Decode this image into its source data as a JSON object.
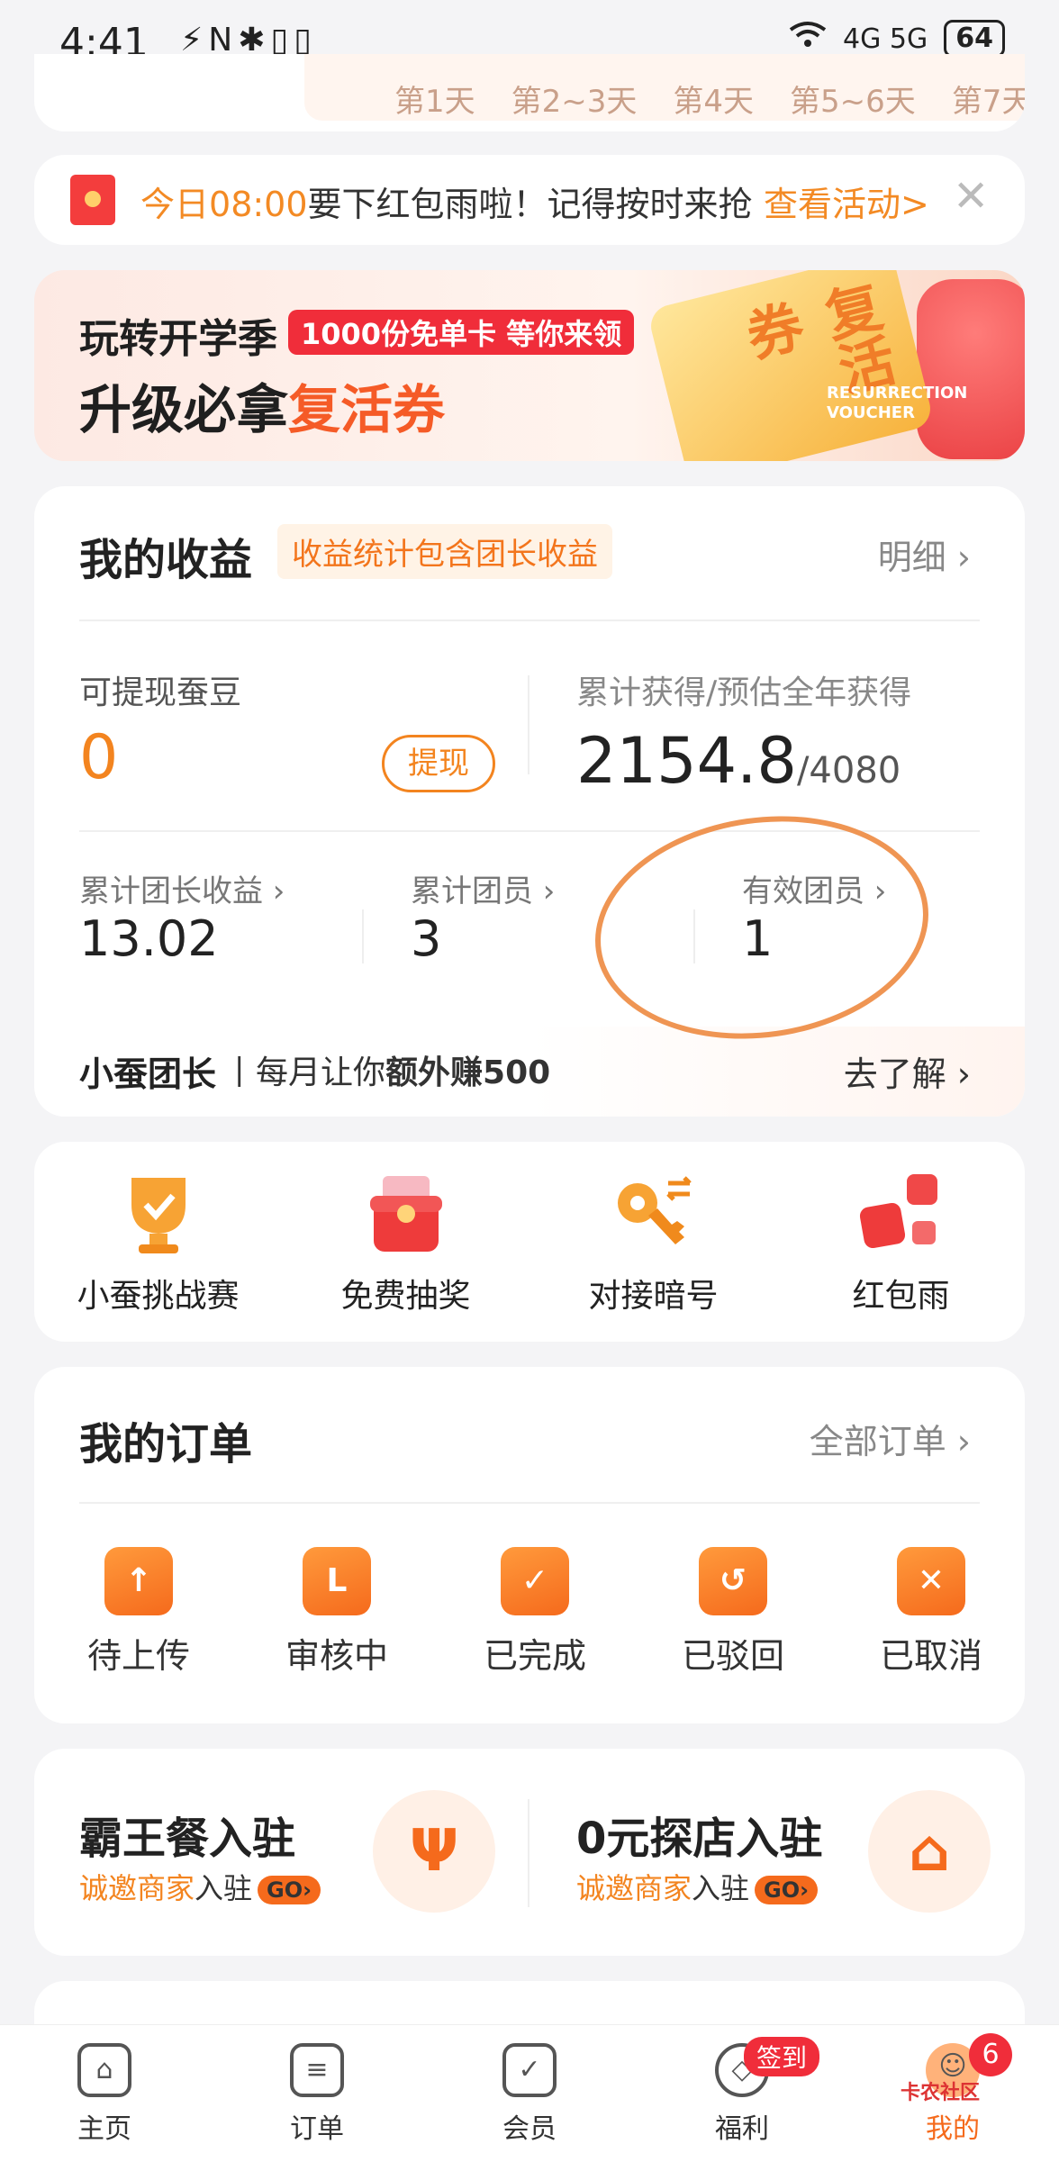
{
  "status_bar": {
    "time": "4:41",
    "left_icons": "⚡N✱▯▯",
    "network": "4G 5G",
    "battery": "64"
  },
  "top_strip": {
    "days": [
      "第1天",
      "第2~3天",
      "第4天",
      "第5~6天",
      "第7天"
    ]
  },
  "notice": {
    "prefix": "今日",
    "time": "08:00",
    "text": "要下红包雨啦！记得按时来抢",
    "link": "查看活动>",
    "close": "✕"
  },
  "banner": {
    "line1": "玩转开学季",
    "badge": "1000份免单卡 等你来领",
    "line2_prefix": "升级必拿",
    "line2_highlight": "复活券",
    "voucher_text": "复活券",
    "voucher_sub": "RESURRECTION VOUCHER"
  },
  "earnings": {
    "title": "我的收益",
    "note": "收益统计包含团长收益",
    "detail": "明细 ›",
    "withdrawable_label": "可提现蚕豆",
    "withdrawable_value": "0",
    "withdraw_button": "提现",
    "total_label": "累计获得/预估全年获得",
    "total_value": "2154.8",
    "total_estimate": "/4080",
    "stats": [
      {
        "label": "累计团长收益 ›",
        "value": "13.02"
      },
      {
        "label": "累计团员 ›",
        "value": "3"
      },
      {
        "label": "有效团员 ›",
        "value": "1"
      }
    ],
    "captain_name": "小蚕团长",
    "captain_text_prefix": "每月让你",
    "captain_text_bold": "额外赚500",
    "captain_link": "去了解 ›"
  },
  "tools": [
    {
      "label": "小蚕挑战赛",
      "icon": "trophy-icon"
    },
    {
      "label": "免费抽奖",
      "icon": "gift-box-icon"
    },
    {
      "label": "对接暗号",
      "icon": "key-icon"
    },
    {
      "label": "红包雨",
      "icon": "red-packet-icon"
    }
  ],
  "orders": {
    "title": "我的订单",
    "all": "全部订单 ›",
    "items": [
      {
        "label": "待上传",
        "glyph": "↑"
      },
      {
        "label": "审核中",
        "glyph": "L"
      },
      {
        "label": "已完成",
        "glyph": "✓"
      },
      {
        "label": "已驳回",
        "glyph": "↺"
      },
      {
        "label": "已取消",
        "glyph": "✕"
      }
    ]
  },
  "merchants": [
    {
      "title": "霸王餐入驻",
      "sub_orange": "诚邀商家",
      "sub_plain": "入驻",
      "go": "GO›",
      "icon_glyph": "Ψ"
    },
    {
      "title": "0元探店入驻",
      "sub_orange": "诚邀商家",
      "sub_plain": "入驻",
      "go": "GO›",
      "icon_glyph": "⌂"
    }
  ],
  "tabbar": {
    "tabs": [
      {
        "label": "主页",
        "glyph": "⌂"
      },
      {
        "label": "订单",
        "glyph": "≡"
      },
      {
        "label": "会员",
        "glyph": "✓"
      },
      {
        "label": "福利",
        "glyph": "◇"
      },
      {
        "label": "我的",
        "glyph": "☺"
      }
    ],
    "sign_badge": "签到",
    "count_badge": "6",
    "watermark": "卡农社区"
  }
}
